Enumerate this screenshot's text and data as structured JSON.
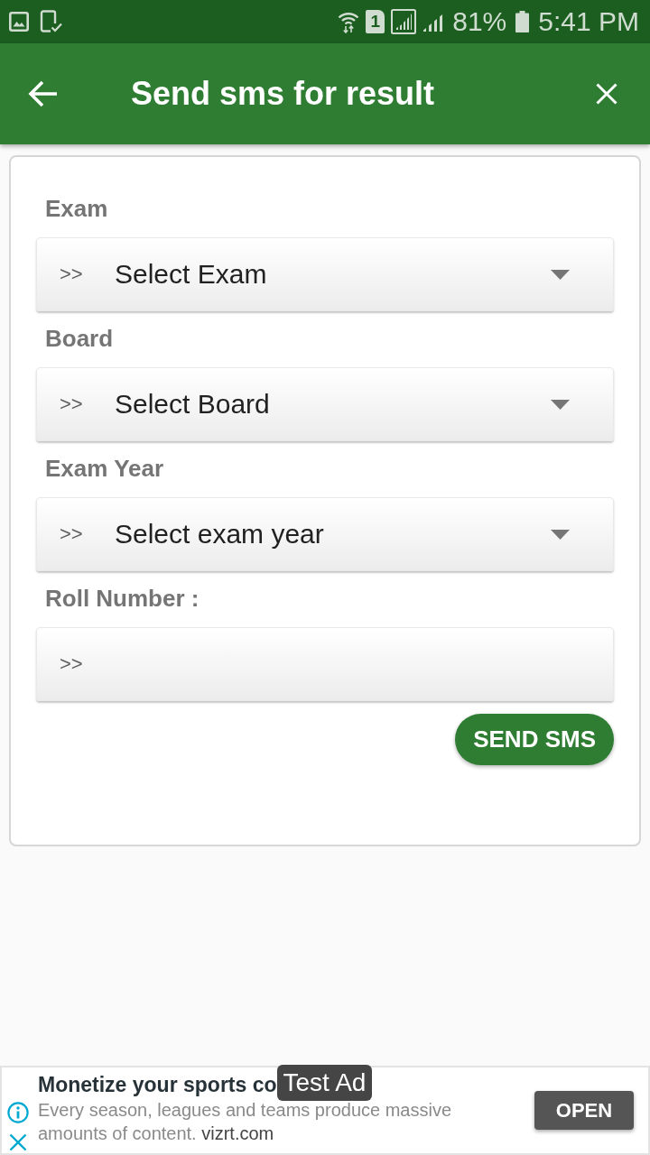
{
  "status_bar": {
    "sim_slot": "1",
    "battery": "81%",
    "time": "5:41 PM"
  },
  "app_bar": {
    "title": "Send sms for result"
  },
  "form": {
    "fields": [
      {
        "kind": "dropdown",
        "label": "Exam",
        "prefix": ">>",
        "value": "Select Exam"
      },
      {
        "kind": "dropdown",
        "label": "Board",
        "prefix": ">>",
        "value": "Select Board"
      },
      {
        "kind": "dropdown",
        "label": "Exam Year",
        "prefix": ">>",
        "value": "Select exam year"
      },
      {
        "kind": "input",
        "label": "Roll Number :",
        "prefix": ">>"
      }
    ],
    "submit_button": "SEND SMS"
  },
  "ad": {
    "headline": "Monetize your sports co",
    "badge": "Test Ad",
    "description": "Every season, leagues and teams produce massive amounts of content.",
    "domain": "vizrt.com",
    "button": "OPEN"
  }
}
